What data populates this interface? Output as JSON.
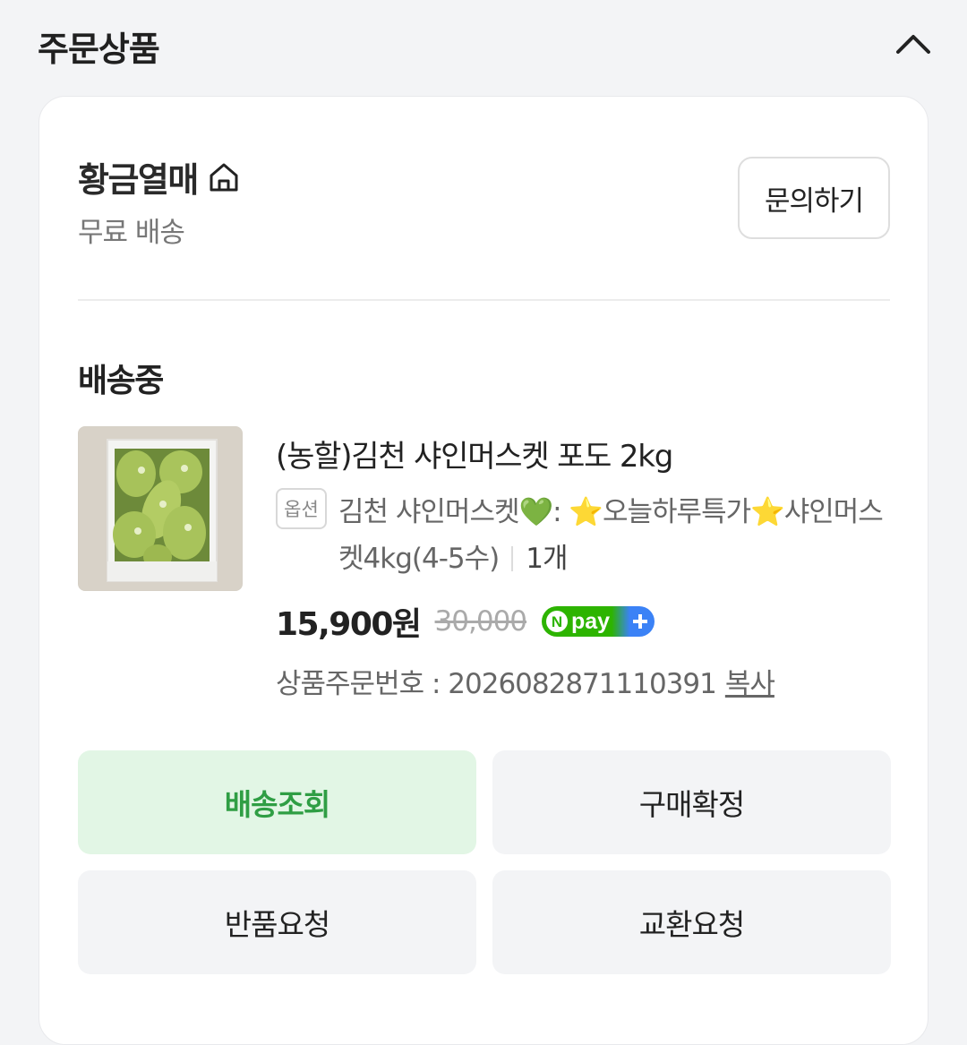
{
  "section": {
    "title": "주문상품"
  },
  "seller": {
    "name": "황금열매",
    "shipping": "무료 배송",
    "inquiry_label": "문의하기"
  },
  "order": {
    "status": "배송중",
    "product_name": "(농할)김천 샤인머스켓 포도 2kg",
    "option_badge": "옵션",
    "option_text": "김천 샤인머스켓💚: ⭐오늘하루특가⭐샤인머스켓4kg(4-5수)",
    "quantity": "1개",
    "price": "15,900원",
    "original_price": "30,000",
    "npay_label": "pay",
    "order_number_label": "상품주문번호 : 2026082871110391",
    "copy_label": "복사"
  },
  "actions": {
    "track": "배송조회",
    "confirm": "구매확정",
    "return": "반품요청",
    "exchange": "교환요청"
  },
  "colors": {
    "accent_green": "#2f9e44",
    "primary_btn_bg": "#e2f6e5",
    "npay_green": "#2db400",
    "npay_blue": "#3b82f6"
  }
}
